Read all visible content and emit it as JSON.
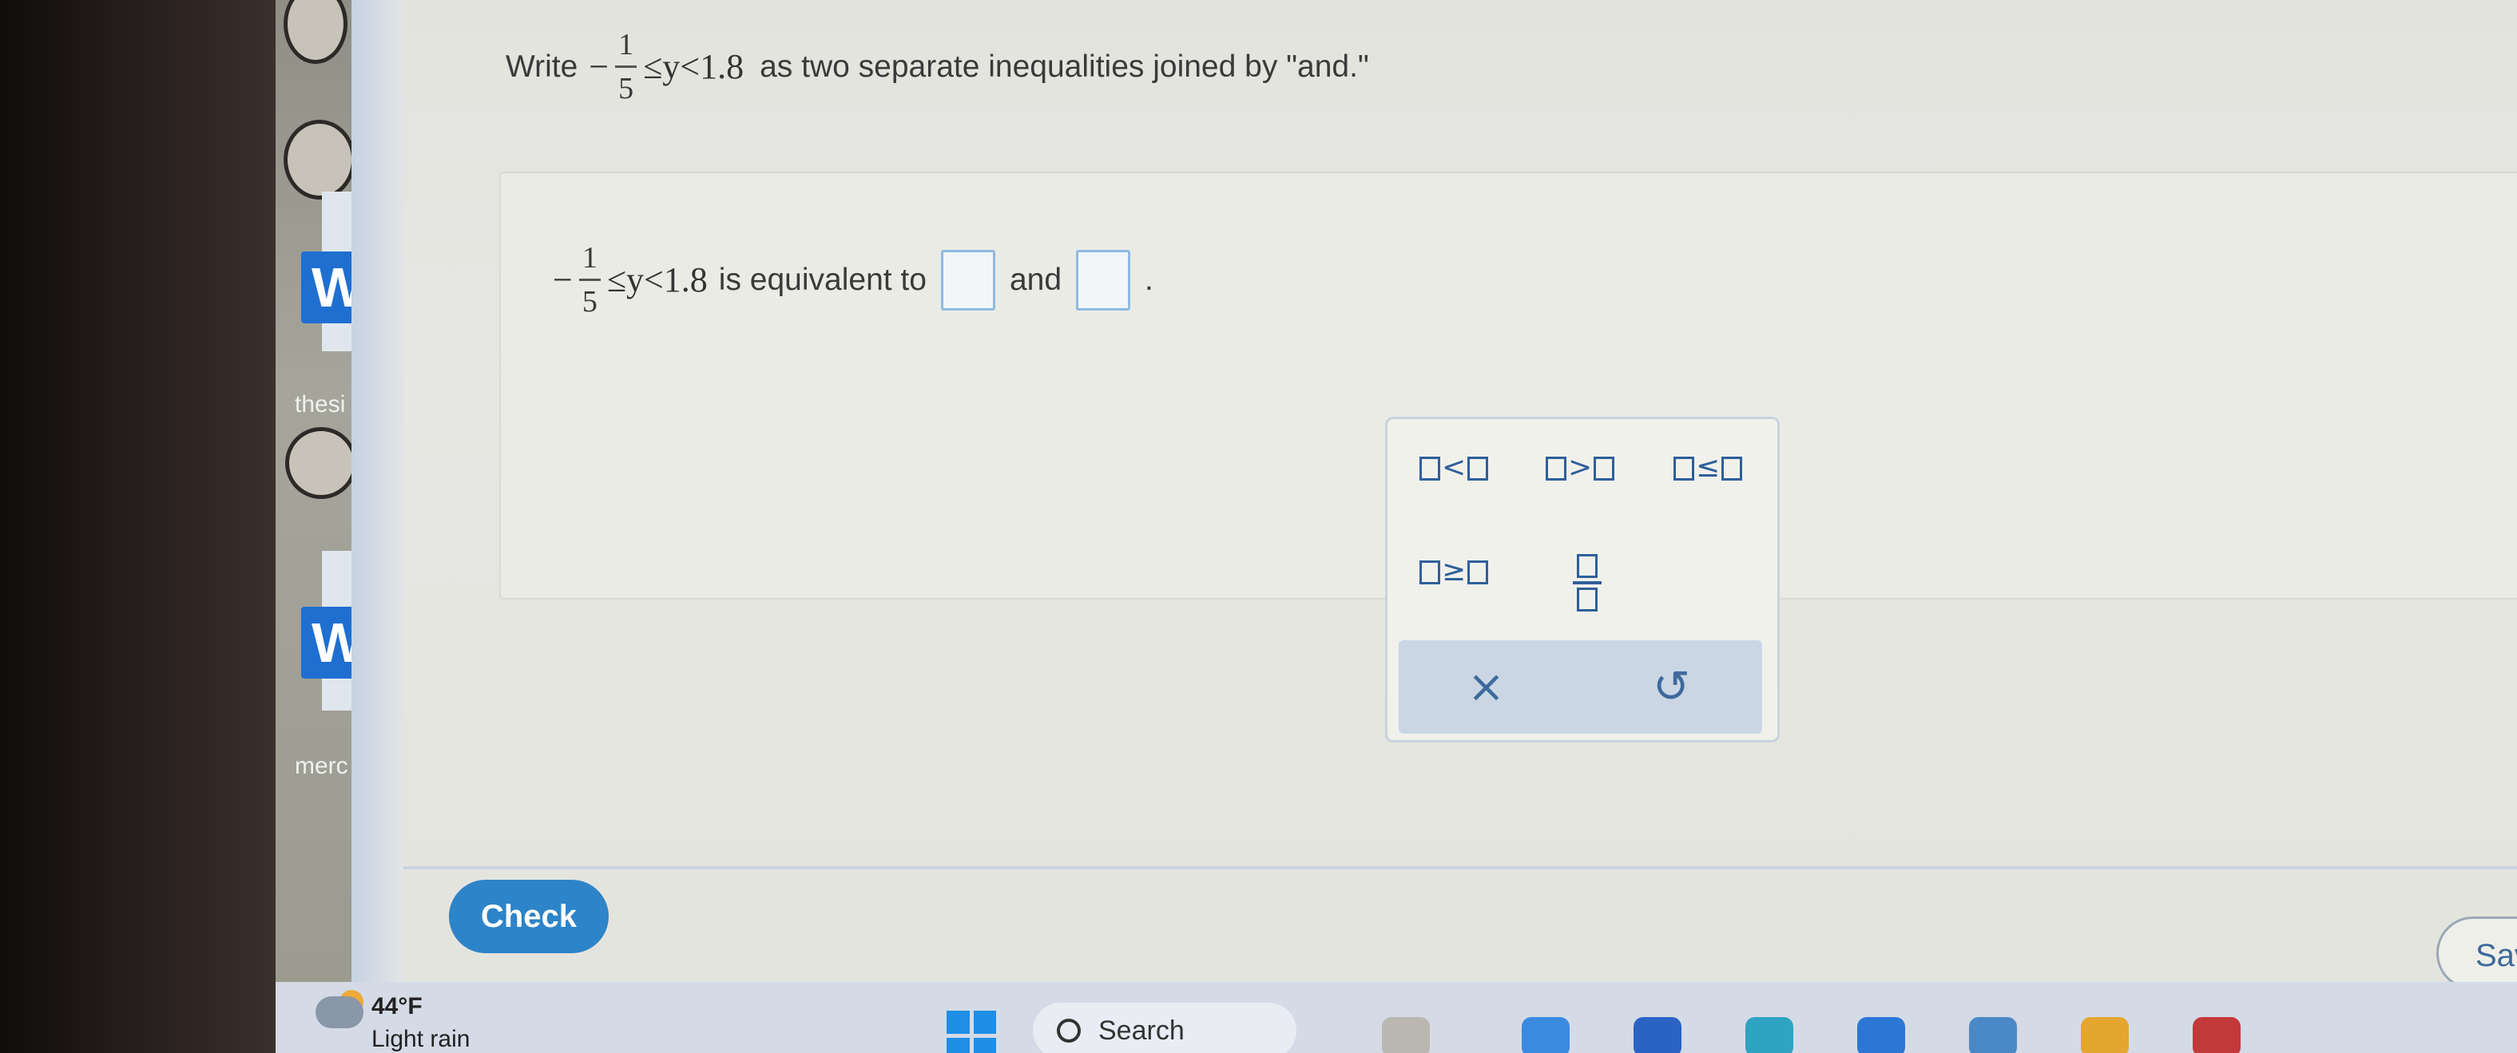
{
  "left_strip": {
    "badge_letter": "W",
    "label_1": "thesi",
    "label_2": "merc"
  },
  "question": {
    "prefix": "Write",
    "minus": "−",
    "frac_num": "1",
    "frac_den": "5",
    "relation": "≤y<1.8",
    "suffix": "as two separate inequalities joined by \"and.\""
  },
  "answer": {
    "minus": "−",
    "frac_num": "1",
    "frac_den": "5",
    "relation": "≤y<1.8",
    "mid_text": "is equivalent to",
    "and_text": "and",
    "end_text": "."
  },
  "palette": {
    "keys": [
      "<",
      ">",
      "≤",
      "≥"
    ],
    "clear_symbol": "×",
    "undo_symbol": "↺"
  },
  "check_label": "Check",
  "save_label": "Sav",
  "taskbar": {
    "temperature": "44°F",
    "condition": "Light rain",
    "search_label": "Search"
  },
  "colors": {
    "accent": "#2d84c8",
    "palette_ink": "#2f5f9a"
  }
}
